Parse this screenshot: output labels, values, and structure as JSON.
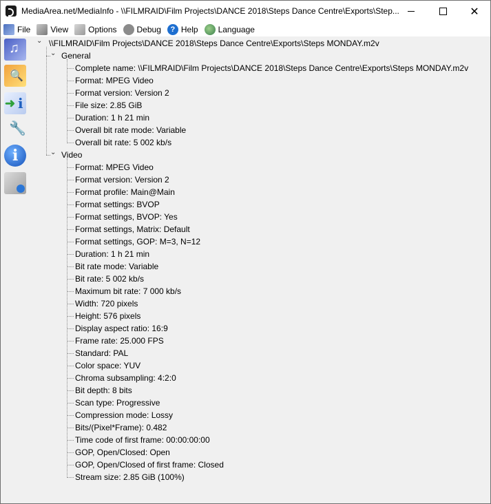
{
  "window": {
    "title": "MediaArea.net/MediaInfo - \\\\FILMRAID\\Film Projects\\DANCE 2018\\Steps Dance Centre\\Exports\\Step...",
    "minimize": "—",
    "maximize": "☐",
    "close": "✕"
  },
  "menu": [
    {
      "label": "File",
      "icon": "file-icon"
    },
    {
      "label": "View",
      "icon": "view-icon"
    },
    {
      "label": "Options",
      "icon": "options-icon"
    },
    {
      "label": "Debug",
      "icon": "debug-icon"
    },
    {
      "label": "Help",
      "icon": "help-icon"
    },
    {
      "label": "Language",
      "icon": "language-icon"
    }
  ],
  "sidebar": [
    {
      "icon": "basic-view-icon"
    },
    {
      "icon": "sheet-view-icon"
    },
    {
      "icon": "export-icon"
    },
    {
      "icon": "preferences-icon"
    },
    {
      "icon": "about-icon"
    },
    {
      "icon": "tree-view-icon"
    }
  ],
  "tree": {
    "root": "\\\\FILMRAID\\Film Projects\\DANCE 2018\\Steps Dance Centre\\Exports\\Steps MONDAY.m2v",
    "sections": [
      {
        "name": "General",
        "items": [
          "Complete name: \\\\FILMRAID\\Film Projects\\DANCE 2018\\Steps Dance Centre\\Exports\\Steps MONDAY.m2v",
          "Format: MPEG Video",
          "Format version: Version 2",
          "File size: 2.85 GiB",
          "Duration: 1 h 21 min",
          "Overall bit rate mode: Variable",
          "Overall bit rate: 5 002 kb/s"
        ]
      },
      {
        "name": "Video",
        "items": [
          "Format: MPEG Video",
          "Format version: Version 2",
          "Format profile: Main@Main",
          "Format settings: BVOP",
          "Format settings, BVOP: Yes",
          "Format settings, Matrix: Default",
          "Format settings, GOP: M=3, N=12",
          "Duration: 1 h 21 min",
          "Bit rate mode: Variable",
          "Bit rate: 5 002 kb/s",
          "Maximum bit rate: 7 000 kb/s",
          "Width: 720 pixels",
          "Height: 576 pixels",
          "Display aspect ratio: 16:9",
          "Frame rate: 25.000 FPS",
          "Standard: PAL",
          "Color space: YUV",
          "Chroma subsampling: 4:2:0",
          "Bit depth: 8 bits",
          "Scan type: Progressive",
          "Compression mode: Lossy",
          "Bits/(Pixel*Frame): 0.482",
          "Time code of first frame: 00:00:00:00",
          "GOP, Open/Closed: Open",
          "GOP, Open/Closed of first frame: Closed",
          "Stream size: 2.85 GiB (100%)"
        ]
      }
    ]
  }
}
